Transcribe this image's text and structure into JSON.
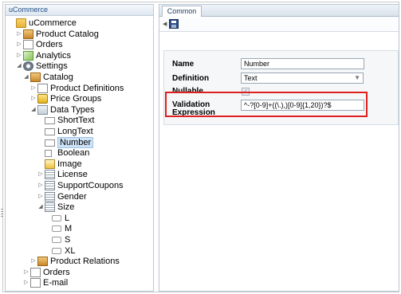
{
  "tree": {
    "header": "uCommerce",
    "nodes": [
      {
        "key": "ucommerce",
        "label": "uCommerce",
        "toggle": "",
        "icon": "i-folder",
        "depth": 0
      },
      {
        "key": "product-catalog",
        "label": "Product Catalog",
        "toggle": "▷",
        "icon": "i-cat",
        "depth": 1
      },
      {
        "key": "orders",
        "label": "Orders",
        "toggle": "▷",
        "icon": "i-page",
        "depth": 1
      },
      {
        "key": "analytics",
        "label": "Analytics",
        "toggle": "▷",
        "icon": "i-chart",
        "depth": 1
      },
      {
        "key": "settings",
        "label": "Settings",
        "toggle": "◢",
        "icon": "i-gear",
        "depth": 1
      },
      {
        "key": "catalog",
        "label": "Catalog",
        "toggle": "◢",
        "icon": "i-cat",
        "depth": 2
      },
      {
        "key": "product-definitions",
        "label": "Product Definitions",
        "toggle": "▷",
        "icon": "i-page",
        "depth": 3
      },
      {
        "key": "price-groups",
        "label": "Price Groups",
        "toggle": "▷",
        "icon": "i-price",
        "depth": 3
      },
      {
        "key": "data-types",
        "label": "Data Types",
        "toggle": "◢",
        "icon": "i-type",
        "depth": 3
      },
      {
        "key": "shorttext",
        "label": "ShortText",
        "toggle": "",
        "icon": "i-field",
        "depth": 4
      },
      {
        "key": "longtext",
        "label": "LongText",
        "toggle": "",
        "icon": "i-field",
        "depth": 4
      },
      {
        "key": "number",
        "label": "Number",
        "toggle": "",
        "icon": "i-field",
        "depth": 4,
        "selected": true
      },
      {
        "key": "boolean",
        "label": "Boolean",
        "toggle": "",
        "icon": "i-check",
        "depth": 4
      },
      {
        "key": "image",
        "label": "Image",
        "toggle": "",
        "icon": "i-img",
        "depth": 4
      },
      {
        "key": "license",
        "label": "License",
        "toggle": "▷",
        "icon": "i-list",
        "depth": 4
      },
      {
        "key": "supportcoupons",
        "label": "SupportCoupons",
        "toggle": "▷",
        "icon": "i-list",
        "depth": 4
      },
      {
        "key": "gender",
        "label": "Gender",
        "toggle": "▷",
        "icon": "i-list",
        "depth": 4
      },
      {
        "key": "size",
        "label": "Size",
        "toggle": "◢",
        "icon": "i-list",
        "depth": 4
      },
      {
        "key": "size-l",
        "label": "L",
        "toggle": "",
        "icon": "i-leaf",
        "depth": 5
      },
      {
        "key": "size-m",
        "label": "M",
        "toggle": "",
        "icon": "i-leaf",
        "depth": 5
      },
      {
        "key": "size-s",
        "label": "S",
        "toggle": "",
        "icon": "i-leaf",
        "depth": 5
      },
      {
        "key": "size-xl",
        "label": "XL",
        "toggle": "",
        "icon": "i-leaf",
        "depth": 5
      },
      {
        "key": "product-relations",
        "label": "Product Relations",
        "toggle": "▷",
        "icon": "i-cat",
        "depth": 3
      },
      {
        "key": "orders-settings",
        "label": "Orders",
        "toggle": "▷",
        "icon": "i-page",
        "depth": 2
      },
      {
        "key": "email",
        "label": "E-mail",
        "toggle": "▷",
        "icon": "i-mail",
        "depth": 2
      }
    ]
  },
  "editor": {
    "tab_label": "Common",
    "form": {
      "name_label": "Name",
      "name_value": "Number",
      "definition_label": "Definition",
      "definition_value": "Text",
      "nullable_label": "Nullable",
      "nullable_checked": true,
      "validation_label_line1": "Validation",
      "validation_label_line2": "Expression",
      "validation_value": "^-?[0-9]+((\\.),)[0-9]{1,20})?$"
    }
  }
}
